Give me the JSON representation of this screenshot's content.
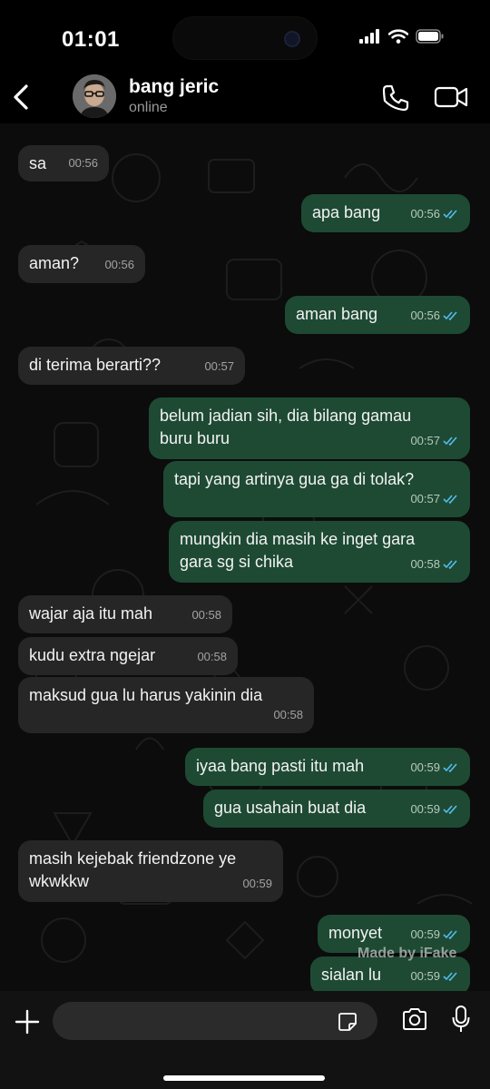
{
  "status_bar": {
    "time": "01:01",
    "icons": [
      "signal-icon",
      "wifi-icon",
      "battery-icon"
    ]
  },
  "header": {
    "contact_name": "bang jeric",
    "contact_status": "online",
    "icons": [
      "back-chevron-icon",
      "phone-icon",
      "video-camera-icon"
    ]
  },
  "messages": [
    {
      "dir": "in",
      "text": "sa",
      "time": "00:56"
    },
    {
      "dir": "out",
      "text": "apa bang",
      "time": "00:56",
      "read": true
    },
    {
      "dir": "in",
      "text": "aman?",
      "time": "00:56"
    },
    {
      "dir": "out",
      "text": "aman bang",
      "time": "00:56",
      "read": true
    },
    {
      "dir": "in",
      "text": "di terima berarti??",
      "time": "00:57"
    },
    {
      "dir": "out",
      "text": "belum jadian sih, dia bilang gamau\nburu buru",
      "time": "00:57",
      "read": true
    },
    {
      "dir": "out",
      "text": "tapi yang artinya gua ga di tolak?",
      "time": "00:57",
      "read": true
    },
    {
      "dir": "out",
      "text": "mungkin dia masih ke inget gara\ngara sg si chika",
      "time": "00:58",
      "read": true
    },
    {
      "dir": "in",
      "text": "wajar aja itu mah",
      "time": "00:58"
    },
    {
      "dir": "in",
      "text": "kudu extra ngejar",
      "time": "00:58"
    },
    {
      "dir": "in",
      "text": "maksud gua lu harus yakinin dia",
      "time": "00:58"
    },
    {
      "dir": "out",
      "text": "iyaa bang pasti itu mah",
      "time": "00:59",
      "read": true
    },
    {
      "dir": "out",
      "text": "gua usahain buat dia",
      "time": "00:59",
      "read": true
    },
    {
      "dir": "in",
      "text": "masih kejebak friendzone ye\nwkwkkw",
      "time": "00:59"
    },
    {
      "dir": "out",
      "text": "monyet",
      "time": "00:59",
      "read": true
    },
    {
      "dir": "out",
      "text": "sialan lu",
      "time": "00:59",
      "read": true
    }
  ],
  "watermark": "Made by iFake",
  "composer": {
    "placeholder": "",
    "icons": [
      "plus-icon",
      "sticker-icon",
      "camera-icon",
      "microphone-icon"
    ]
  },
  "colors": {
    "incoming_bubble": "#262626",
    "outgoing_bubble": "#1e4a34",
    "read_tick": "#53bdeb"
  }
}
